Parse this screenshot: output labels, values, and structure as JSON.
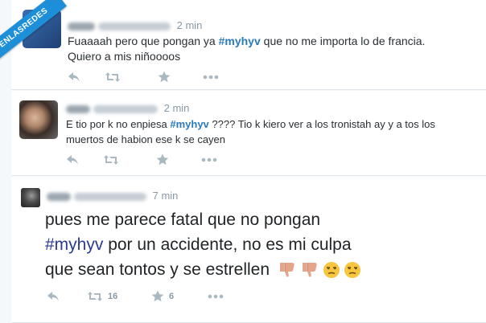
{
  "watermark": "VISTOENLASREDES",
  "tweets": [
    {
      "time": "2 min",
      "text_before": "Fuaaaah pero que pongan ya ",
      "hashtag": "#myhyv",
      "text_after": " que no me importa lo de francia.",
      "line2": "Quiero a mis niñoooos",
      "retweets": "",
      "favorites": ""
    },
    {
      "time": "2 min",
      "text_before": "E tio por k no enpiesa ",
      "hashtag": "#myhyv",
      "text_after": " ???? Tio k kiero ver a los tronistah ay y a tos los",
      "line2": "muertos de habion ese k se cayen",
      "retweets": "",
      "favorites": ""
    },
    {
      "time": "7 min",
      "line1": "pues me parece fatal que no pongan",
      "hashtag": "#myhyv",
      "line2_after": " por un accidente, no es mi culpa",
      "line3": "que sean tontos y se estrellen",
      "retweets": "16",
      "favorites": "6"
    }
  ],
  "icons": [
    "reply-icon",
    "retweet-icon",
    "favorite-icon",
    "more-icon",
    "thumbs-down-emoji",
    "unamused-emoji"
  ],
  "colors": {
    "hashtag": "#2b7bb9",
    "icon": "#aab8c2",
    "banner": "#1d8fd8"
  }
}
